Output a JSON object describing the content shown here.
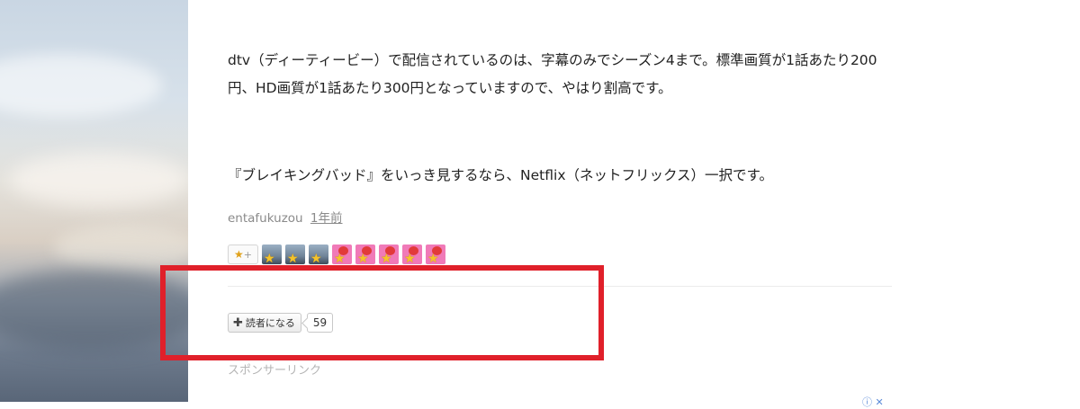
{
  "article": {
    "paragraph1": "dtv（ディーティービー）で配信されているのは、字幕のみでシーズン4まで。標準画質が1話あたり200円、HD画質が1話あたり300円となっていますので、やはり割高です。",
    "paragraph2": "『ブレイキングバッド』をいっき見するなら、Netflix（ネットフリックス）一択です。"
  },
  "meta": {
    "author": "entafukuzou",
    "time": "1年前"
  },
  "stars": {
    "add_label": "★",
    "add_plus": "+",
    "star_glyph": "★",
    "avatars": [
      "blue",
      "blue",
      "blue",
      "pink",
      "pink",
      "pink",
      "pink",
      "pink"
    ]
  },
  "subscribe": {
    "plus": "✚",
    "label": "読者になる",
    "count": "59"
  },
  "sponsor_label": "スポンサーリンク",
  "ad_choice": "ⓘ ✕",
  "colors": {
    "highlight_border": "#e0202a",
    "star": "#f4c32a",
    "pink_avatar": "#f07ab8"
  }
}
